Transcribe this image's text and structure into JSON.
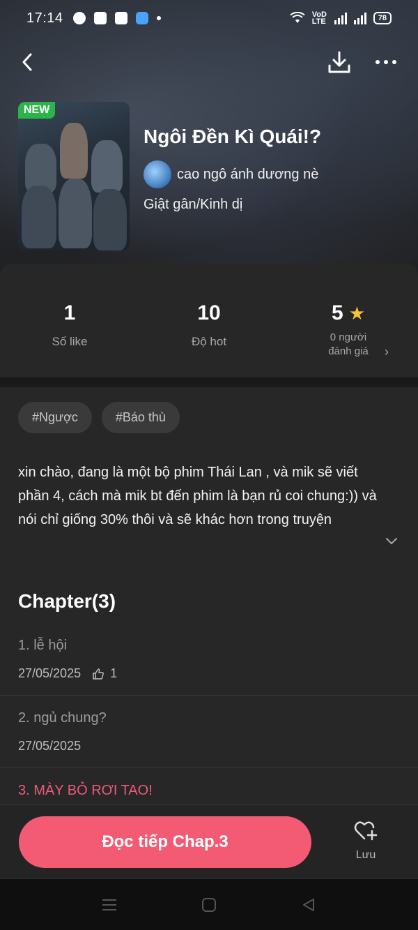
{
  "status_bar": {
    "time": "17:14",
    "signal_text": "VoD LTE",
    "battery": "78"
  },
  "story": {
    "badge": "NEW",
    "title": "Ngôi Đền Kì Quái!?",
    "author": "cao ngô ánh dương nè",
    "genre": "Giật gân/Kinh dị"
  },
  "stats": {
    "likes": {
      "value": "1",
      "label": "Số like"
    },
    "hot": {
      "value": "10",
      "label": "Độ hot"
    },
    "rating": {
      "value": "5",
      "label_line1": "0 người",
      "label_line2": "đánh giá"
    }
  },
  "tags": [
    "#Ngược",
    "#Báo thù"
  ],
  "description": "xin chào, đang là một bộ phim Thái Lan , và mik sẽ viết phần 4, cách mà mik bt đến phim là bạn rủ coi chung:)) và nói chỉ giống 30% thôi và sẽ khác hơn trong truyện",
  "chapters_header": "Chapter(3)",
  "chapters": [
    {
      "title": "1. lễ hội",
      "date": "27/05/2025",
      "likes": "1"
    },
    {
      "title": "2. ngủ chung?",
      "date": "27/05/2025"
    },
    {
      "title": "3. MÀY BỎ RƠI TAO!"
    }
  ],
  "bottom": {
    "read_button": "Đọc tiếp Chap.3",
    "save_label": "Lưu"
  },
  "colors": {
    "accent": "#f25b73",
    "active_chapter": "#ef5a78",
    "star": "#f6c33a",
    "new_badge": "#2bb44a"
  }
}
